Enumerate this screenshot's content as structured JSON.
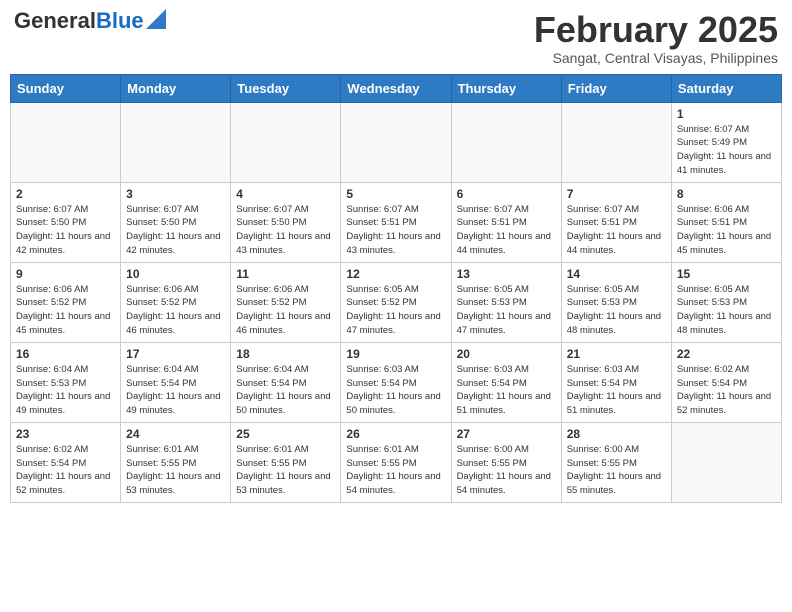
{
  "header": {
    "logo_general": "General",
    "logo_blue": "Blue",
    "month_year": "February 2025",
    "location": "Sangat, Central Visayas, Philippines"
  },
  "weekdays": [
    "Sunday",
    "Monday",
    "Tuesday",
    "Wednesday",
    "Thursday",
    "Friday",
    "Saturday"
  ],
  "weeks": [
    [
      {
        "day": "",
        "info": ""
      },
      {
        "day": "",
        "info": ""
      },
      {
        "day": "",
        "info": ""
      },
      {
        "day": "",
        "info": ""
      },
      {
        "day": "",
        "info": ""
      },
      {
        "day": "",
        "info": ""
      },
      {
        "day": "1",
        "info": "Sunrise: 6:07 AM\nSunset: 5:49 PM\nDaylight: 11 hours and 41 minutes."
      }
    ],
    [
      {
        "day": "2",
        "info": "Sunrise: 6:07 AM\nSunset: 5:50 PM\nDaylight: 11 hours and 42 minutes."
      },
      {
        "day": "3",
        "info": "Sunrise: 6:07 AM\nSunset: 5:50 PM\nDaylight: 11 hours and 42 minutes."
      },
      {
        "day": "4",
        "info": "Sunrise: 6:07 AM\nSunset: 5:50 PM\nDaylight: 11 hours and 43 minutes."
      },
      {
        "day": "5",
        "info": "Sunrise: 6:07 AM\nSunset: 5:51 PM\nDaylight: 11 hours and 43 minutes."
      },
      {
        "day": "6",
        "info": "Sunrise: 6:07 AM\nSunset: 5:51 PM\nDaylight: 11 hours and 44 minutes."
      },
      {
        "day": "7",
        "info": "Sunrise: 6:07 AM\nSunset: 5:51 PM\nDaylight: 11 hours and 44 minutes."
      },
      {
        "day": "8",
        "info": "Sunrise: 6:06 AM\nSunset: 5:51 PM\nDaylight: 11 hours and 45 minutes."
      }
    ],
    [
      {
        "day": "9",
        "info": "Sunrise: 6:06 AM\nSunset: 5:52 PM\nDaylight: 11 hours and 45 minutes."
      },
      {
        "day": "10",
        "info": "Sunrise: 6:06 AM\nSunset: 5:52 PM\nDaylight: 11 hours and 46 minutes."
      },
      {
        "day": "11",
        "info": "Sunrise: 6:06 AM\nSunset: 5:52 PM\nDaylight: 11 hours and 46 minutes."
      },
      {
        "day": "12",
        "info": "Sunrise: 6:05 AM\nSunset: 5:52 PM\nDaylight: 11 hours and 47 minutes."
      },
      {
        "day": "13",
        "info": "Sunrise: 6:05 AM\nSunset: 5:53 PM\nDaylight: 11 hours and 47 minutes."
      },
      {
        "day": "14",
        "info": "Sunrise: 6:05 AM\nSunset: 5:53 PM\nDaylight: 11 hours and 48 minutes."
      },
      {
        "day": "15",
        "info": "Sunrise: 6:05 AM\nSunset: 5:53 PM\nDaylight: 11 hours and 48 minutes."
      }
    ],
    [
      {
        "day": "16",
        "info": "Sunrise: 6:04 AM\nSunset: 5:53 PM\nDaylight: 11 hours and 49 minutes."
      },
      {
        "day": "17",
        "info": "Sunrise: 6:04 AM\nSunset: 5:54 PM\nDaylight: 11 hours and 49 minutes."
      },
      {
        "day": "18",
        "info": "Sunrise: 6:04 AM\nSunset: 5:54 PM\nDaylight: 11 hours and 50 minutes."
      },
      {
        "day": "19",
        "info": "Sunrise: 6:03 AM\nSunset: 5:54 PM\nDaylight: 11 hours and 50 minutes."
      },
      {
        "day": "20",
        "info": "Sunrise: 6:03 AM\nSunset: 5:54 PM\nDaylight: 11 hours and 51 minutes."
      },
      {
        "day": "21",
        "info": "Sunrise: 6:03 AM\nSunset: 5:54 PM\nDaylight: 11 hours and 51 minutes."
      },
      {
        "day": "22",
        "info": "Sunrise: 6:02 AM\nSunset: 5:54 PM\nDaylight: 11 hours and 52 minutes."
      }
    ],
    [
      {
        "day": "23",
        "info": "Sunrise: 6:02 AM\nSunset: 5:54 PM\nDaylight: 11 hours and 52 minutes."
      },
      {
        "day": "24",
        "info": "Sunrise: 6:01 AM\nSunset: 5:55 PM\nDaylight: 11 hours and 53 minutes."
      },
      {
        "day": "25",
        "info": "Sunrise: 6:01 AM\nSunset: 5:55 PM\nDaylight: 11 hours and 53 minutes."
      },
      {
        "day": "26",
        "info": "Sunrise: 6:01 AM\nSunset: 5:55 PM\nDaylight: 11 hours and 54 minutes."
      },
      {
        "day": "27",
        "info": "Sunrise: 6:00 AM\nSunset: 5:55 PM\nDaylight: 11 hours and 54 minutes."
      },
      {
        "day": "28",
        "info": "Sunrise: 6:00 AM\nSunset: 5:55 PM\nDaylight: 11 hours and 55 minutes."
      },
      {
        "day": "",
        "info": ""
      }
    ]
  ]
}
